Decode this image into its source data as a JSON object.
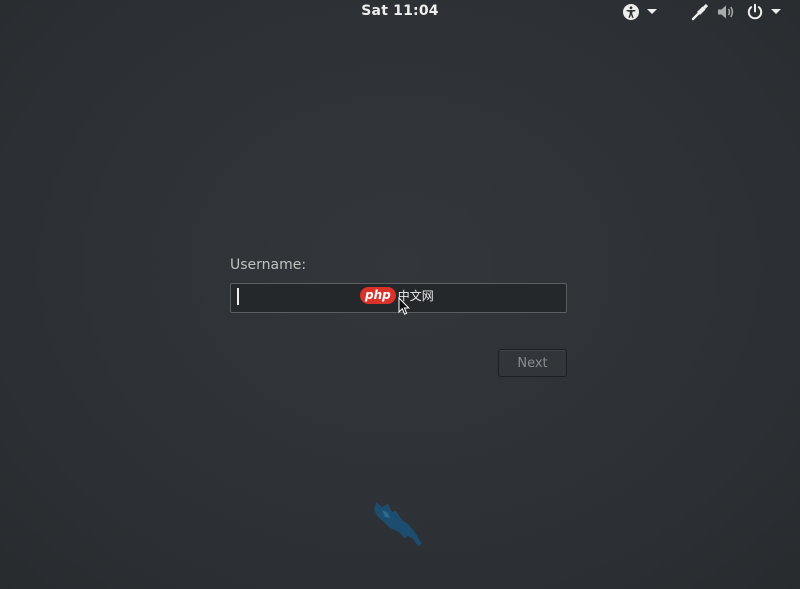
{
  "topbar": {
    "clock": "Sat 11:04",
    "icons": [
      "accessibility-icon",
      "dropdown-arrow-icon",
      "network-wired-icon",
      "volume-icon",
      "power-icon",
      "dropdown-arrow-icon"
    ]
  },
  "login": {
    "username_label": "Username:",
    "username_value": "",
    "next_label": "Next"
  },
  "watermark": {
    "badge": "php",
    "text": "中文网"
  },
  "colors": {
    "background": "#2e3236",
    "panel_text": "#eeeeec",
    "logo": "#1c4d6e"
  }
}
